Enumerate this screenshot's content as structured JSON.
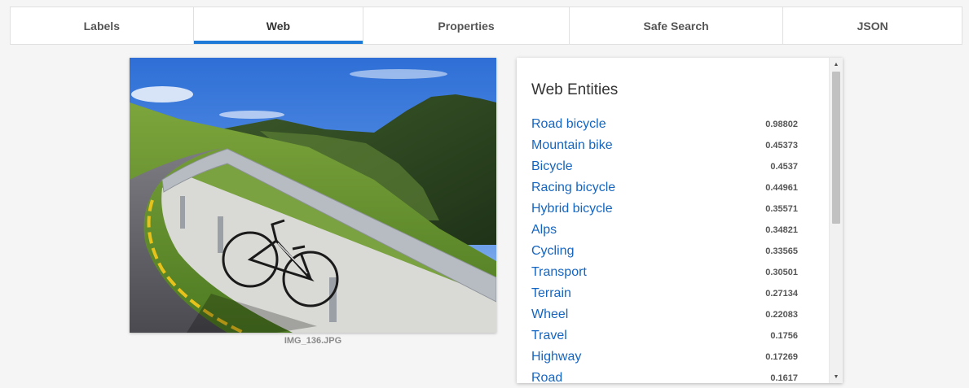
{
  "tabs": [
    {
      "label": "Labels",
      "active": false
    },
    {
      "label": "Web",
      "active": true
    },
    {
      "label": "Properties",
      "active": false
    },
    {
      "label": "Safe Search",
      "active": false
    },
    {
      "label": "JSON",
      "active": false
    }
  ],
  "image": {
    "caption": "IMG_136.JPG",
    "depicts": "road bicycle leaning on guardrail of mountain road"
  },
  "panel": {
    "title": "Web Entities",
    "entities": [
      {
        "name": "Road bicycle",
        "score": "0.98802"
      },
      {
        "name": "Mountain bike",
        "score": "0.45373"
      },
      {
        "name": "Bicycle",
        "score": "0.4537"
      },
      {
        "name": "Racing bicycle",
        "score": "0.44961"
      },
      {
        "name": "Hybrid bicycle",
        "score": "0.35571"
      },
      {
        "name": "Alps",
        "score": "0.34821"
      },
      {
        "name": "Cycling",
        "score": "0.33565"
      },
      {
        "name": "Transport",
        "score": "0.30501"
      },
      {
        "name": "Terrain",
        "score": "0.27134"
      },
      {
        "name": "Wheel",
        "score": "0.22083"
      },
      {
        "name": "Travel",
        "score": "0.1756"
      },
      {
        "name": "Highway",
        "score": "0.17269"
      },
      {
        "name": "Road",
        "score": "0.1617"
      }
    ]
  },
  "scrollbar": {
    "up_icon": "triangle-up-icon",
    "down_icon": "triangle-down-icon"
  },
  "colors": {
    "accent": "#1e7ad6",
    "link": "#1565c0",
    "background": "#f5f5f5"
  }
}
